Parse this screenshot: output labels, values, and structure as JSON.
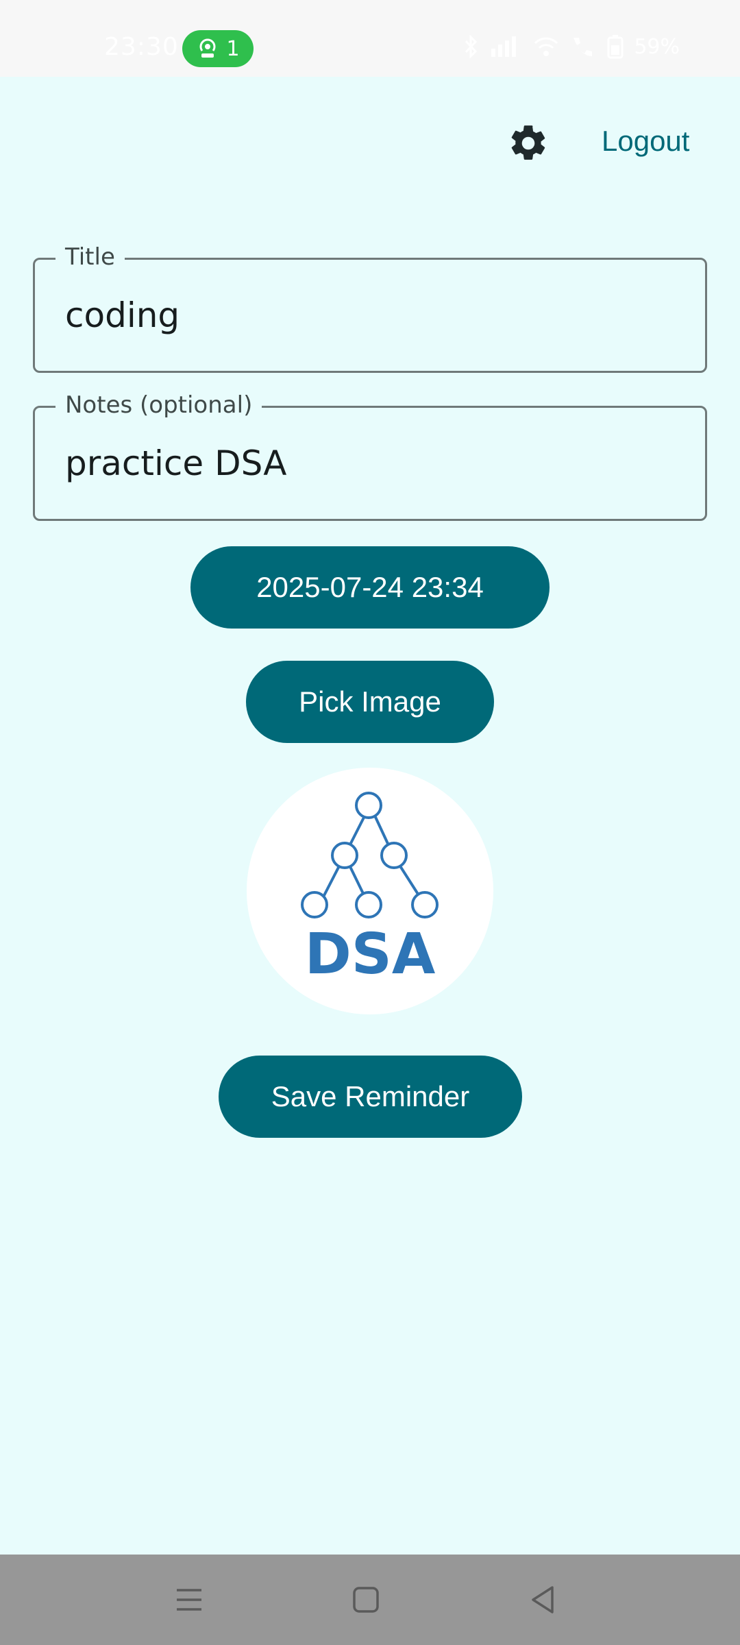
{
  "status_bar": {
    "time": "23:30",
    "hotspot_count": "1",
    "battery": "59%",
    "icons": [
      "bluetooth-icon",
      "signal-icon",
      "wifi-icon",
      "call-icon",
      "battery-icon"
    ]
  },
  "header": {
    "settings_icon": "gear-icon",
    "logout_label": "Logout"
  },
  "form": {
    "title": {
      "label": "Title",
      "value": "coding"
    },
    "notes": {
      "label": "Notes (optional)",
      "value": "practice DSA"
    },
    "datetime_label": "2025-07-24 23:34",
    "pick_image_label": "Pick Image",
    "image_text": "DSA",
    "save_label": "Save Reminder"
  },
  "nav_bar": {
    "icons": [
      "menu-icon",
      "home-icon",
      "back-icon"
    ]
  },
  "colors": {
    "background": "#e8fcfc",
    "primary": "#006978",
    "outline": "#6f7979",
    "logo_blue": "#2e75b6",
    "hotspot_green": "#2fbf4d"
  }
}
